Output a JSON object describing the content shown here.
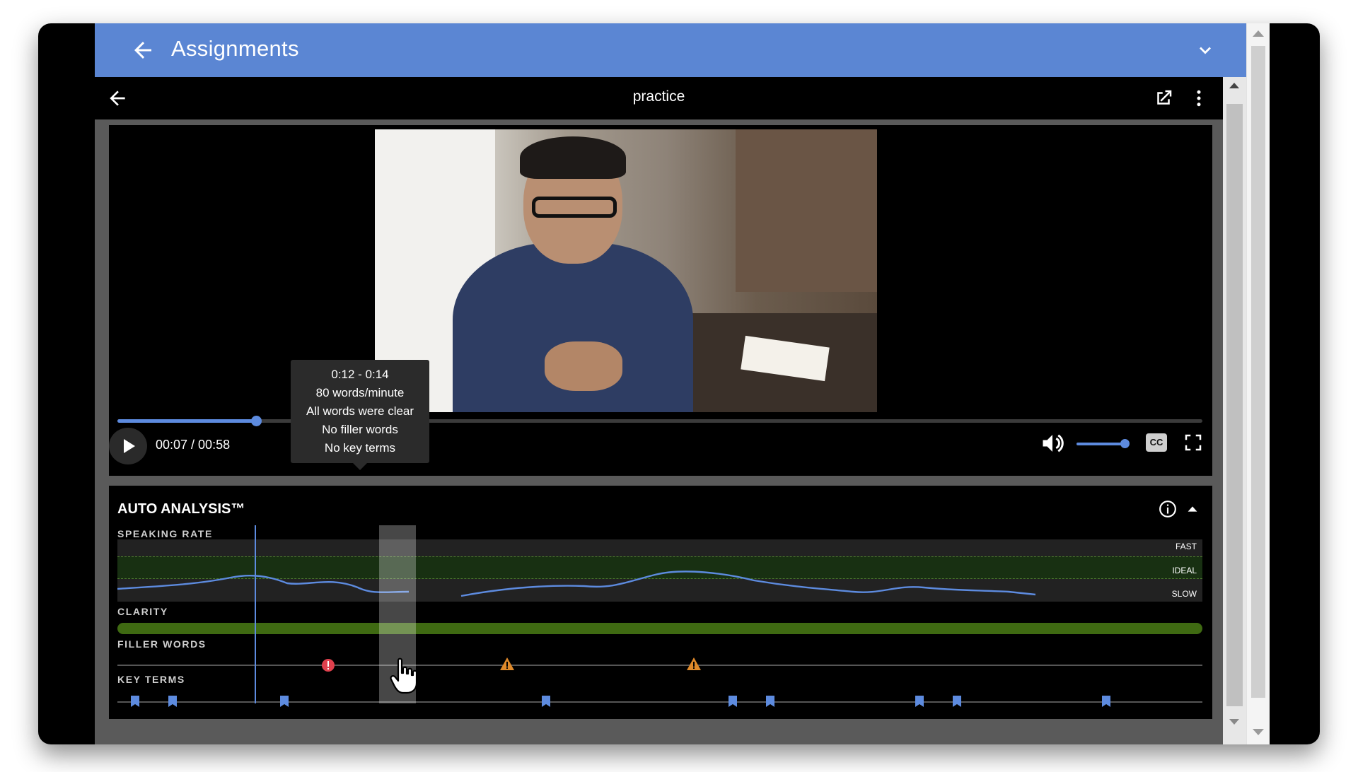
{
  "app": {
    "title": "Assignments"
  },
  "viewer": {
    "title": "practice"
  },
  "player": {
    "time_display": "00:07 / 00:58",
    "progress_fraction": 0.128,
    "volume_fraction": 1.0,
    "cc_label": "CC"
  },
  "tooltip": {
    "range": "0:12 - 0:14",
    "line1": "80 words/minute",
    "line2": "All words were clear",
    "line3": "No filler words",
    "line4": "No key terms"
  },
  "analysis": {
    "title": "AUTO ANALYSIS™",
    "speaking_rate": {
      "label": "SPEAKING RATE",
      "fast": "FAST",
      "ideal": "IDEAL",
      "slow": "SLOW"
    },
    "clarity": {
      "label": "CLARITY"
    },
    "filler_words": {
      "label": "FILLER WORDS"
    },
    "key_terms": {
      "label": "KEY TERMS"
    }
  },
  "colors": {
    "header_blue": "#5b86d3",
    "accent_blue": "#5d8bdf",
    "clarity_green": "#3f6a12",
    "filler_red": "#e0404d",
    "filler_orange": "#e08a2a"
  }
}
